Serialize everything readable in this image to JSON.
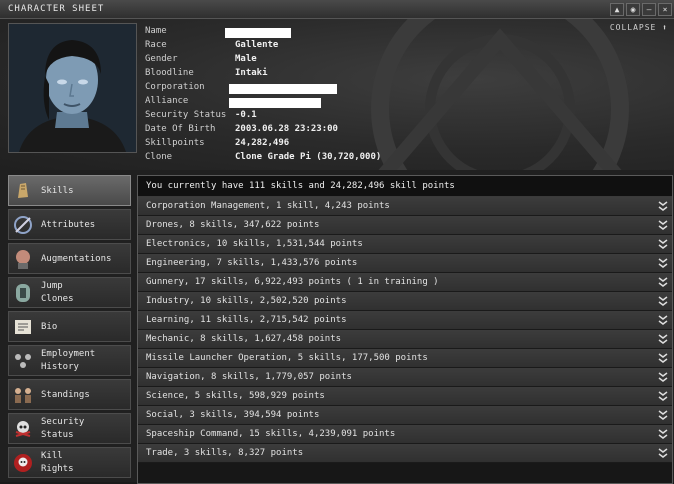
{
  "window": {
    "title": "CHARACTER SHEET",
    "collapse_label": "COLLAPSE",
    "buttons": [
      "▲",
      "◉",
      "–",
      "×"
    ]
  },
  "character": {
    "fields": [
      {
        "label": "Name",
        "value": "",
        "redacted": true
      },
      {
        "label": "Race",
        "value": "Gallente",
        "redacted": false
      },
      {
        "label": "Gender",
        "value": "Male",
        "redacted": false
      },
      {
        "label": "Bloodline",
        "value": "Intaki",
        "redacted": false
      },
      {
        "label": "Corporation",
        "value": "",
        "redacted": true
      },
      {
        "label": "Alliance",
        "value": "",
        "redacted": true
      },
      {
        "label": "Security Status",
        "value": "-0.1",
        "redacted": false
      },
      {
        "label": "Date Of Birth",
        "value": "2003.06.28  23:23:00",
        "redacted": false
      },
      {
        "label": "Skillpoints",
        "value": "24,282,496",
        "redacted": false
      },
      {
        "label": "Clone",
        "value": "Clone Grade Pi (30,720,000)",
        "redacted": false
      }
    ]
  },
  "sidebar": {
    "items": [
      {
        "line1": "Skills",
        "line2": "",
        "icon": "skills-icon",
        "active": true
      },
      {
        "line1": "Attributes",
        "line2": "",
        "icon": "attributes-icon",
        "active": false
      },
      {
        "line1": "Augmentations",
        "line2": "",
        "icon": "augmentations-icon",
        "active": false
      },
      {
        "line1": "Jump",
        "line2": "Clones",
        "icon": "jump-clones-icon",
        "active": false
      },
      {
        "line1": "Bio",
        "line2": "",
        "icon": "bio-icon",
        "active": false
      },
      {
        "line1": "Employment",
        "line2": "History",
        "icon": "employment-history-icon",
        "active": false
      },
      {
        "line1": "Standings",
        "line2": "",
        "icon": "standings-icon",
        "active": false
      },
      {
        "line1": "Security",
        "line2": "Status",
        "icon": "security-status-icon",
        "active": false
      },
      {
        "line1": "Kill",
        "line2": "Rights",
        "icon": "kill-rights-icon",
        "active": false
      }
    ]
  },
  "skills": {
    "summary": "You currently have 111 skills and 24,282,496 skill points",
    "groups": [
      "Corporation Management, 1 skill, 4,243 points",
      "Drones, 8 skills, 347,622 points",
      "Electronics, 10 skills, 1,531,544 points",
      "Engineering, 7 skills, 1,433,576 points",
      "Gunnery, 17 skills, 6,922,493 points ( 1 in training )",
      "Industry, 10 skills, 2,502,520 points",
      "Learning, 11 skills, 2,715,542 points",
      "Mechanic, 8 skills, 1,627,458 points",
      "Missile Launcher Operation, 5 skills, 177,500 points",
      "Navigation, 8 skills, 1,779,057 points",
      "Science, 5 skills, 598,929 points",
      "Social, 3 skills, 394,594 points",
      "Spaceship Command, 15 skills, 4,239,091 points",
      "Trade, 3 skills, 8,327 points"
    ]
  }
}
